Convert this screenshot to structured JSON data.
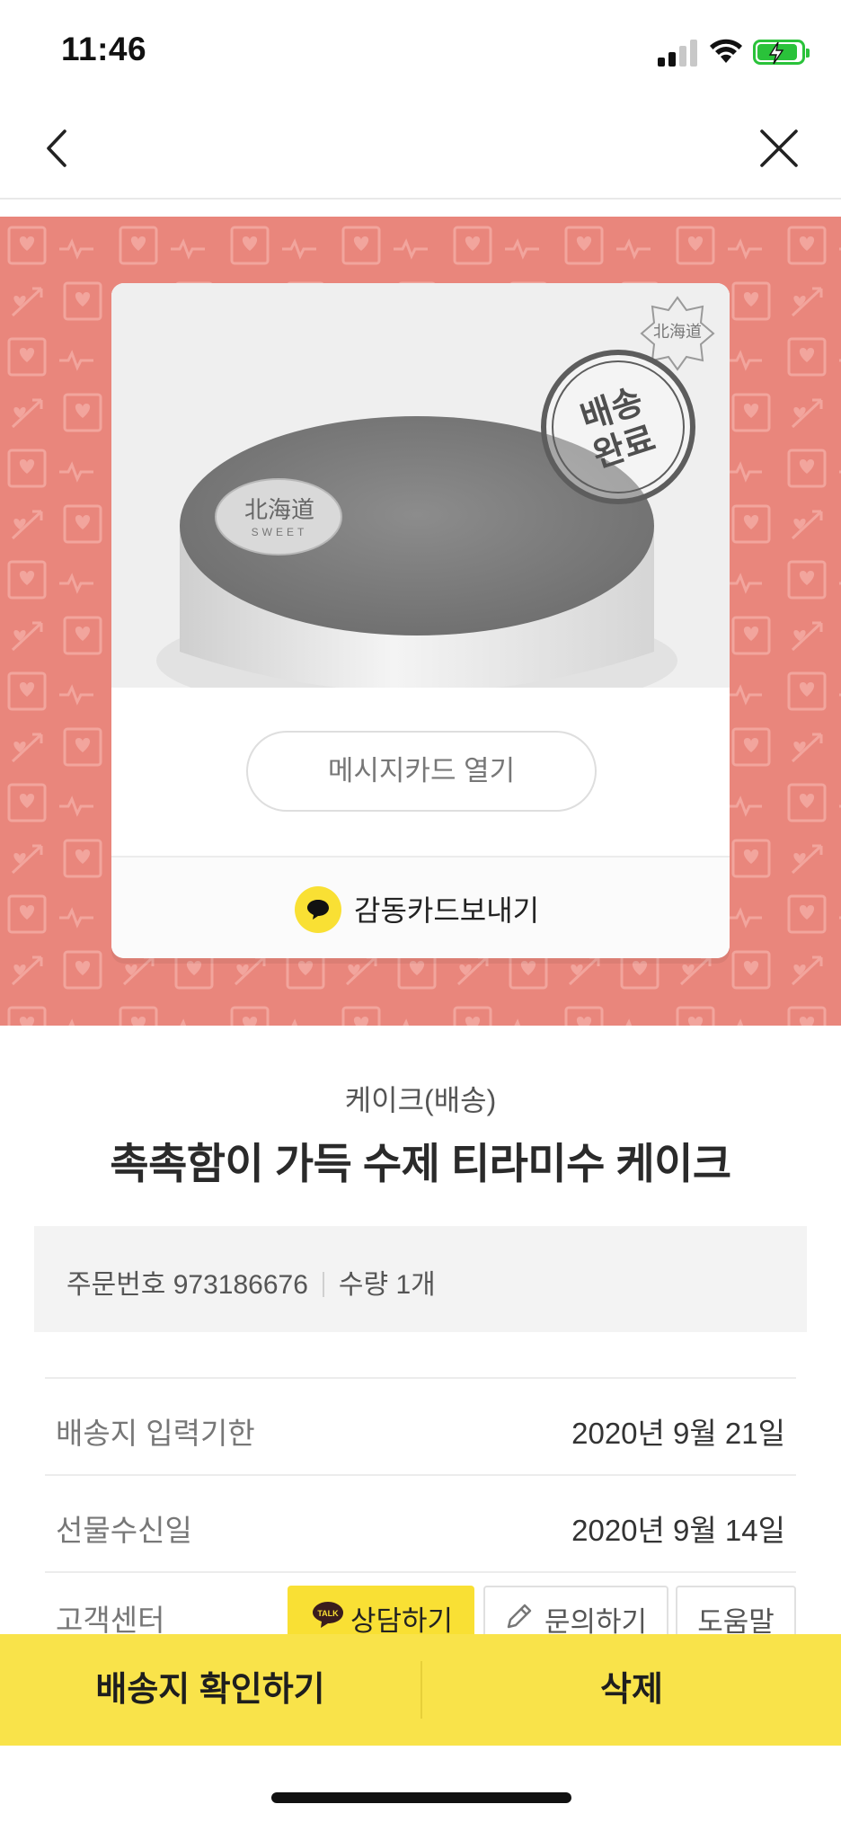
{
  "status_bar": {
    "time": "11:46"
  },
  "product_image": {
    "brand_name": "北海道",
    "brand_sub": "SWEET",
    "stamp_text": "배송\n완료"
  },
  "gift_card": {
    "message_card_button": "메시지카드 열기",
    "send_card_label": "감동카드보내기"
  },
  "product": {
    "category": "케이크(배송)",
    "title": "촉촉함이 가득 수제 티라미수 케이크"
  },
  "order": {
    "order_number": "주문번호 973186676",
    "quantity": "수량 1개"
  },
  "details": [
    {
      "label": "배송지 입력기한",
      "value": "2020년 9월 21일"
    },
    {
      "label": "선물수신일",
      "value": "2020년 9월 14일"
    }
  ],
  "customer_center": {
    "label": "고객센터",
    "talk_label": "상담하기",
    "inquiry_label": "문의하기",
    "help_label": "도움말"
  },
  "bottom_bar": {
    "confirm_address": "배송지 확인하기",
    "delete": "삭제"
  },
  "colors": {
    "hero_bg": "#e9867c",
    "kakao_yellow": "#f9e034",
    "battery_green": "#2ac23a"
  }
}
